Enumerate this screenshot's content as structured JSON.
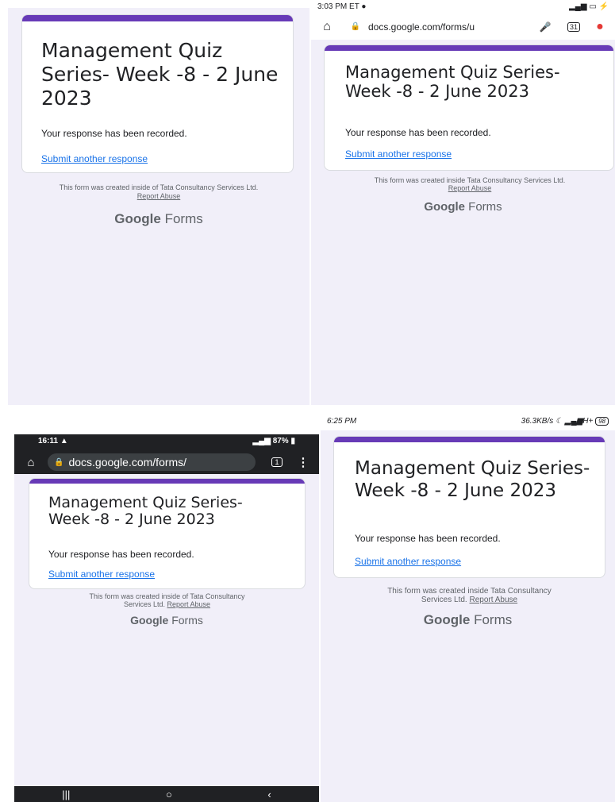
{
  "form": {
    "title": "Management Quiz Series- Week -8 - 2 June 2023",
    "response_recorded": "Your response has been recorded.",
    "submit_another": "Submit another response",
    "report_abuse": "Report Abuse",
    "brand_google": "Google",
    "brand_forms": "Forms"
  },
  "panel1": {
    "footer_text": "This form was created inside of Tata Consultancy Services Ltd."
  },
  "panel2": {
    "status_time": "3:03 PM ET",
    "url": "docs.google.com/forms/u",
    "tab_count": "31",
    "footer_text": "This form was created inside Tata Consultancy Services Ltd."
  },
  "panel3": {
    "status_time": "16:11",
    "status_battery": "87%",
    "url": "docs.google.com/forms/",
    "tab_count": "1",
    "footer_line1": "This form was created inside of Tata Consultancy",
    "footer_line2": "Services Ltd."
  },
  "panel4": {
    "status_time": "6:25 PM",
    "status_speed": "36.3KB/s",
    "status_net": "H+",
    "status_battery": "98",
    "footer_line1": "This form was created inside Tata Consultancy",
    "footer_line2": "Services Ltd."
  },
  "colors": {
    "accent": "#673ab7",
    "link": "#1a73e8",
    "page_bg": "#f1eff9"
  }
}
